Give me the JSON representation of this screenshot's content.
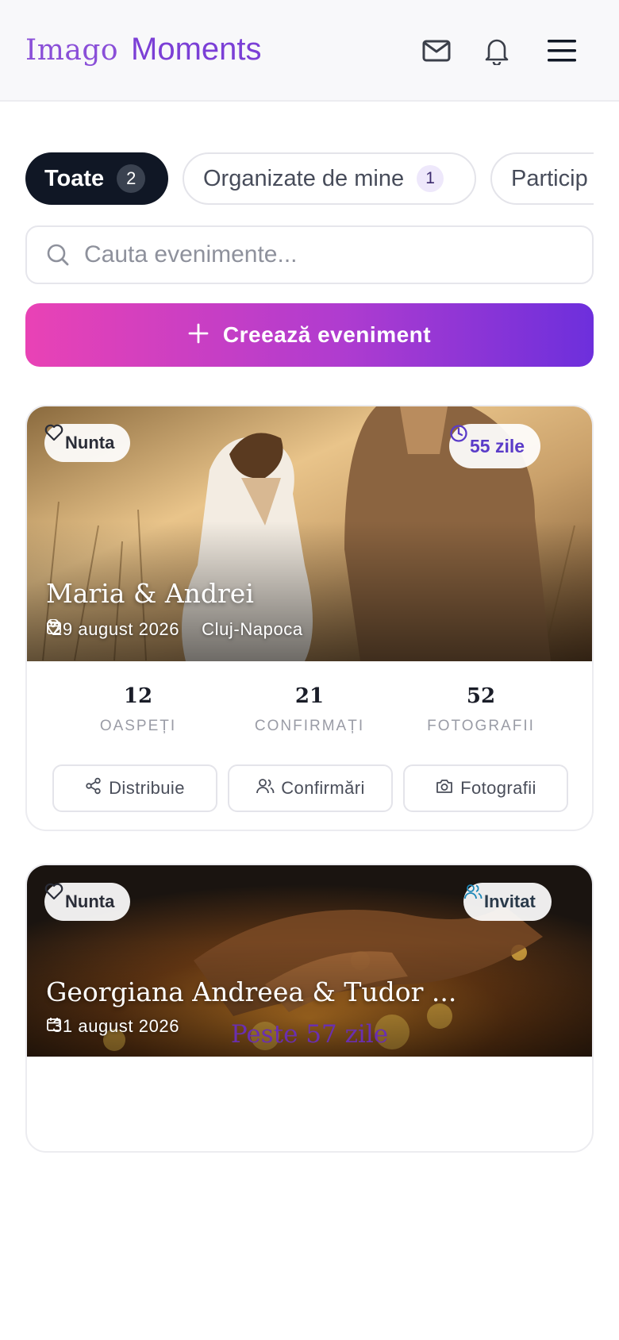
{
  "header": {
    "logo_part1": "Imago",
    "logo_part2": "Moments",
    "icons": [
      "mail-icon",
      "bell-icon",
      "menu-icon"
    ]
  },
  "filters": {
    "tabs": [
      {
        "label": "Toate",
        "count": "2",
        "active": true
      },
      {
        "label": "Organizate de mine",
        "count": "1",
        "active": false
      },
      {
        "label": "Particip",
        "count": "",
        "active": false
      }
    ]
  },
  "search": {
    "placeholder": "Cauta evenimente..."
  },
  "create_button": {
    "label": "Creează eveniment"
  },
  "events": [
    {
      "type": "Nunta",
      "badge": "55 zile",
      "title": "Maria & Andrei",
      "date": "29 august 2026",
      "location": "Cluj-Napoca",
      "stats": [
        {
          "value": "12",
          "label": "OASPEȚI"
        },
        {
          "value": "21",
          "label": "CONFIRMAȚI"
        },
        {
          "value": "52",
          "label": "FOTOGRAFII"
        }
      ],
      "actions": [
        "Distribuie",
        "Confirmări",
        "Fotografii"
      ]
    },
    {
      "type": "Nunta",
      "badge": "Invitat",
      "title": "Georgiana Andreea & Tudor ...",
      "date": "31 august 2026",
      "countdown": "Peste 57 zile"
    }
  ],
  "colors": {
    "brand": "#7b3fd6",
    "gradient_start": "#e942b5",
    "gradient_end": "#6d2fdc",
    "active_tab": "#101725"
  }
}
